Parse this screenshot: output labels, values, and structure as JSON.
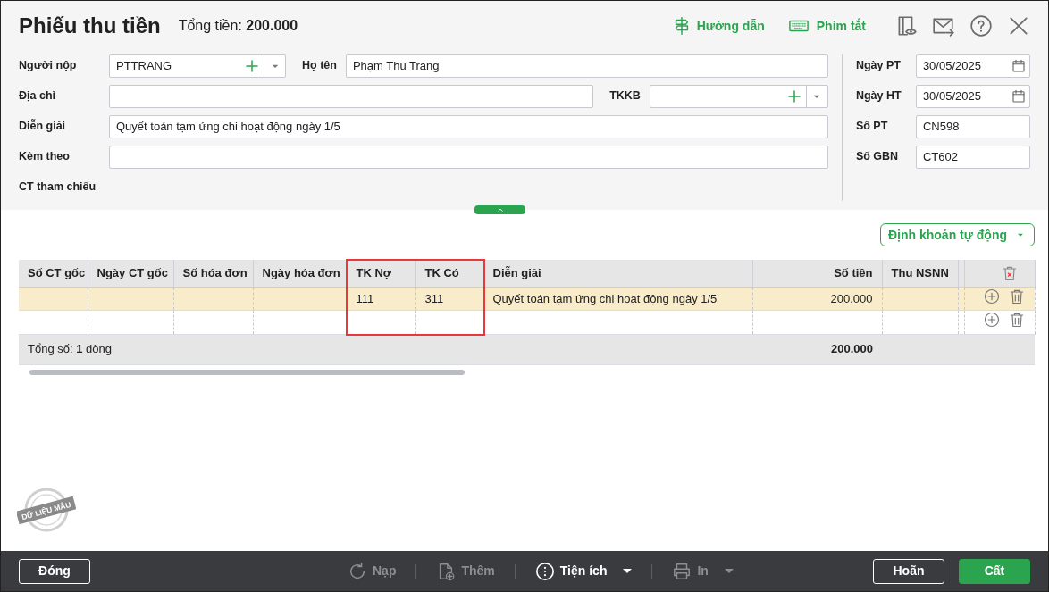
{
  "title": "Phiếu thu tiền",
  "total": {
    "label": "Tổng tiền:",
    "value": "200.000"
  },
  "header_links": [
    {
      "kind": "guide",
      "label": "Hướng dẫn"
    },
    {
      "kind": "shortcuts",
      "label": "Phím tắt"
    }
  ],
  "form_rows": [
    [
      {
        "label": "Người nộp",
        "kind": "lookup",
        "value": "PTTRANG"
      },
      {
        "label": "Họ tên",
        "kind": "text",
        "value": "Phạm Thu Trang"
      }
    ],
    [
      {
        "label": "Địa chỉ",
        "kind": "text"
      },
      {
        "label": "TKKB",
        "kind": "lookup"
      }
    ],
    [
      {
        "label": "Diễn giải",
        "kind": "text",
        "value": "Quyết toán tạm ứng chi hoạt động ngày 1/5"
      }
    ],
    [
      {
        "label": "Kèm theo",
        "kind": "text"
      }
    ],
    [
      {
        "label": "CT tham chiếu",
        "kind": "none"
      }
    ]
  ],
  "side_fields": [
    {
      "label": "Ngày PT",
      "kind": "date",
      "value": "30/05/2025"
    },
    {
      "label": "Ngày HT",
      "kind": "date",
      "value": "30/05/2025"
    },
    {
      "label": "Số PT",
      "kind": "text",
      "value": "CN598"
    },
    {
      "label": "Số GBN",
      "kind": "text",
      "value": "CT602"
    }
  ],
  "auto_posting_button": "Định khoản tự động",
  "table": {
    "columns": [
      {
        "label": "Số CT gốc",
        "kind": "text",
        "highlighted": false
      },
      {
        "label": "Ngày CT gốc",
        "kind": "text",
        "highlighted": false
      },
      {
        "label": "Số hóa đơn",
        "kind": "text",
        "highlighted": false
      },
      {
        "label": "Ngày hóa đơn",
        "kind": "text",
        "highlighted": false
      },
      {
        "label": "TK Nợ",
        "kind": "text",
        "highlighted": true
      },
      {
        "label": "TK Có",
        "kind": "text",
        "highlighted": true
      },
      {
        "label": "Diễn giải",
        "kind": "text",
        "highlighted": false
      },
      {
        "label": "Số tiền",
        "kind": "amount",
        "highlighted": false
      },
      {
        "label": "Thu NSNN",
        "kind": "text",
        "highlighted": false
      }
    ],
    "rows": [
      {
        "selected": true,
        "cells": [
          null,
          null,
          null,
          null,
          "111",
          "311",
          "Quyết toán tạm ứng chi hoạt động ngày 1/5",
          "200.000",
          null
        ]
      },
      {
        "selected": false,
        "cells": [
          null,
          null,
          null,
          null,
          null,
          null,
          null,
          null,
          null
        ]
      }
    ],
    "summary": {
      "label": "Tổng số: **1** dòng",
      "total": "200.000"
    }
  },
  "stamp": "DỮ LIỆU MẪU",
  "footer": {
    "close_button": "Đóng",
    "tools": [
      {
        "kind": "reload",
        "label": "Nạp",
        "disabled": true,
        "dropdown": false
      },
      {
        "kind": "add",
        "label": "Thêm",
        "disabled": true,
        "dropdown": false
      },
      {
        "kind": "utilities",
        "label": "Tiện ích",
        "disabled": false,
        "dropdown": true
      },
      {
        "kind": "print",
        "label": "In",
        "disabled": true,
        "dropdown": true
      }
    ],
    "buttons": [
      {
        "kind": "secondary",
        "label": "Hoãn"
      },
      {
        "kind": "primary",
        "label": "Cất"
      }
    ]
  }
}
